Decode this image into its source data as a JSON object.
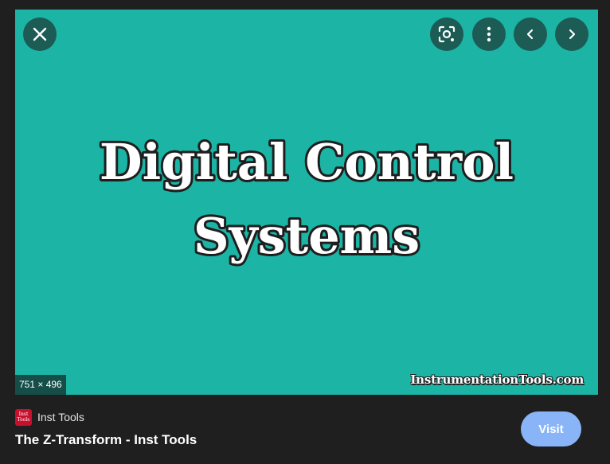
{
  "image": {
    "headline_line1": "Digital Control",
    "headline_line2": "Systems",
    "watermark": "InstrumentationTools.com",
    "dimensions": "751 × 496",
    "background_color": "#1bb4a5"
  },
  "toolbar": {
    "close_icon": "close-icon",
    "lens_icon": "google-lens-icon",
    "more_icon": "more-vert-icon",
    "prev_icon": "chevron-left-icon",
    "next_icon": "chevron-right-icon"
  },
  "source": {
    "favicon_text_line1": "Inst",
    "favicon_text_line2": "Tools",
    "name": "Inst Tools"
  },
  "result": {
    "title": "The Z-Transform - Inst Tools",
    "visit_label": "Visit",
    "visit_color": "#8ab4f8"
  }
}
